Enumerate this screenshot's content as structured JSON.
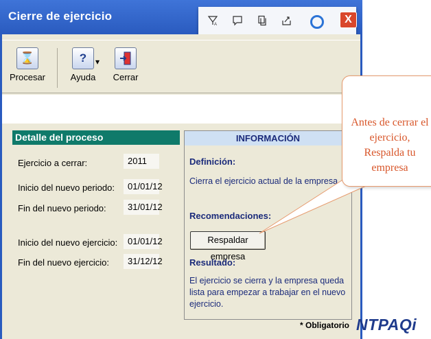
{
  "window": {
    "title": "Cierre de ejercicio",
    "close_glyph": "X"
  },
  "browser_toolbar": {
    "icons": [
      "read-aloud-icon",
      "comment-icon",
      "copy-icon",
      "share-icon",
      "cortana-icon"
    ]
  },
  "toolbar": {
    "procesar_label": "Procesar",
    "ayuda_label": "Ayuda",
    "cerrar_label": "Cerrar",
    "ayuda_dropdown_glyph": "▾"
  },
  "detalle": {
    "header": "Detalle del proceso",
    "rows": [
      {
        "label": "Ejercicio a cerrar:",
        "value": "2011"
      },
      {
        "label": "Inicio del nuevo periodo:",
        "value": "01/01/12"
      },
      {
        "label": "Fin del nuevo periodo:",
        "value": "31/01/12"
      },
      {
        "label": "Inicio del nuevo ejercicio:",
        "value": "01/01/12"
      },
      {
        "label": "Fin del nuevo ejercicio:",
        "value": "31/12/12"
      }
    ]
  },
  "informacion": {
    "header": "INFORMACIÓN",
    "definicion_title": "Definición:",
    "definicion_text": "Cierra el ejercicio actual de la empresa.",
    "recomendaciones_title": "Recomendaciones:",
    "respaldar_button": "Respaldar empresa",
    "resultado_title": "Resultado:",
    "resultado_text": "El ejercicio se cierra y la empresa queda lista para empezar a trabajar en el nuevo ejercicio."
  },
  "footer": {
    "obligatorio": "* Obligatorio",
    "logo": "NTPAQi"
  },
  "callout": {
    "text": "Antes de cerrar el ejercicio, Respalda tu empresa"
  },
  "colors": {
    "titlebar": "#2a5bbf",
    "detalle_header": "#0f7a6a",
    "info_text": "#1a2a7a",
    "callout_text": "#d8562a",
    "close_button": "#d9472b"
  }
}
